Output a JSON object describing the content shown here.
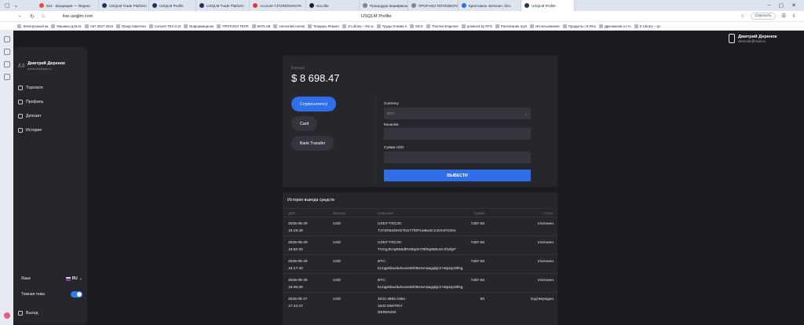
{
  "browser": {
    "tabs": [
      {
        "label": "524 · Входящие — Яндекс",
        "color": "#e64b3c"
      },
      {
        "label": "USQLM Trade Platform",
        "color": "#20345f"
      },
      {
        "label": "USQLM Profile",
        "color": "#20345f"
      },
      {
        "label": "USQLM Trade Platform",
        "color": "#20345f"
      },
      {
        "label": "Account TJTZREhDHG7K",
        "color": "#d93a3a"
      },
      {
        "label": "sso.title",
        "color": "#222222"
      },
      {
        "label": "Процедура верификации",
        "color": "#7a8494"
      },
      {
        "label": "ПРОГНОЗ ТЕПЛОВОГО П",
        "color": "#7a8494"
      },
      {
        "label": "Криптовюк. Биткоин, бло",
        "color": "#2f6ee8"
      },
      {
        "label": "USQLM Profile",
        "color": "#20345f",
        "active": true
      }
    ],
    "url": "live.usqjlm.com",
    "page_title": "USQLM Profile",
    "ask_button": "Спросить",
    "bookmarks": [
      "Электронный ка",
      "Машины для вс",
      "А67 3027-2024",
      "Представители",
      "Convert TEX to D",
      "Информационн",
      "ПРОГНОЗ ТЕПЛ",
      "MATLAB",
      "memorials.tomsk",
      "Тендеры Ремонт",
      "Z-Library – the w",
      "Труды Очкова п",
      "MCS",
      "Thermal Engineer",
      "powered by RTS",
      "Расписание груп",
      "Использование",
      "Продукты | К-Flex",
      "Дренажная и сто",
      "Z-Library – кр"
    ]
  },
  "profile_header": {
    "name": "Дмитрий Деренок",
    "email": "derenok@mail.ru"
  },
  "sidebar": {
    "avatar_initials": "Д Д",
    "user_name": "Дмитрий Деренок",
    "user_email": "derenok@mail.ru",
    "menu": [
      {
        "label": "Торговля"
      },
      {
        "label": "Профиль"
      },
      {
        "label": "Депозит"
      },
      {
        "label": "История"
      }
    ],
    "language_label": "Язык",
    "language_value": "RU",
    "theme_label": "Темная тема",
    "theme_on": true,
    "logout_label": "Выход"
  },
  "balance": {
    "label": "Баланс",
    "value": "$ 8 698.47"
  },
  "methods": [
    {
      "label": "Cryptocurrency",
      "active": true
    },
    {
      "label": "Card",
      "active": false
    },
    {
      "label": "Bank Transfer",
      "active": false
    }
  ],
  "withdraw_form": {
    "currency_label": "Currency",
    "currency_value": "BTC",
    "wallet_label": "Кошелек",
    "wallet_value": "",
    "amount_label": "Сумма USD",
    "amount_value": "",
    "submit_label": "ВЫВЕСТИ"
  },
  "history": {
    "title": "История вывода средств",
    "columns": {
      "date": "Дата",
      "currency": "Валюта",
      "description": "Описание",
      "amount": "Сумма",
      "status": "Статус"
    },
    "rows": [
      {
        "date": "2025-08-29\n19:19:49",
        "currency": "USD",
        "description": "USDT-TRC20:\nTJTZREeDHG7KS77fSP1w8w4CmGXvPZ3Hv",
        "amount": "7287.65",
        "status": "отклонен"
      },
      {
        "date": "2025-08-29\n18:50:32",
        "currency": "USD",
        "description": "USDT-TRC20:\nTVGgJKnqR66dRVMq3mT9f3qMMUoCrfzdQP",
        "amount": "7287.65",
        "status": "отклонен"
      },
      {
        "date": "2025-08-29\n18:17:40",
        "currency": "USD",
        "description": "BTC:\nbc1qp5kaufa3vvwsd009e4vnaagqkjc2+8qwrp20lsg",
        "amount": "7287.65",
        "status": "отклонен"
      },
      {
        "date": "2025-08-28\n18:46:28",
        "currency": "USD",
        "description": "BTC:\nbc1qp5kaufa3vvwsd009e4vnaagqkjc2+8qwrp20lsg",
        "amount": "7287.65",
        "status": "отклонен"
      },
      {
        "date": "2025-08-27\n17:44:47",
        "currency": "USD",
        "description": "4041-3692-1951-\n1642 DMITRIY\nDERENOK",
        "amount": "50",
        "status": "подтвержден"
      }
    ]
  }
}
